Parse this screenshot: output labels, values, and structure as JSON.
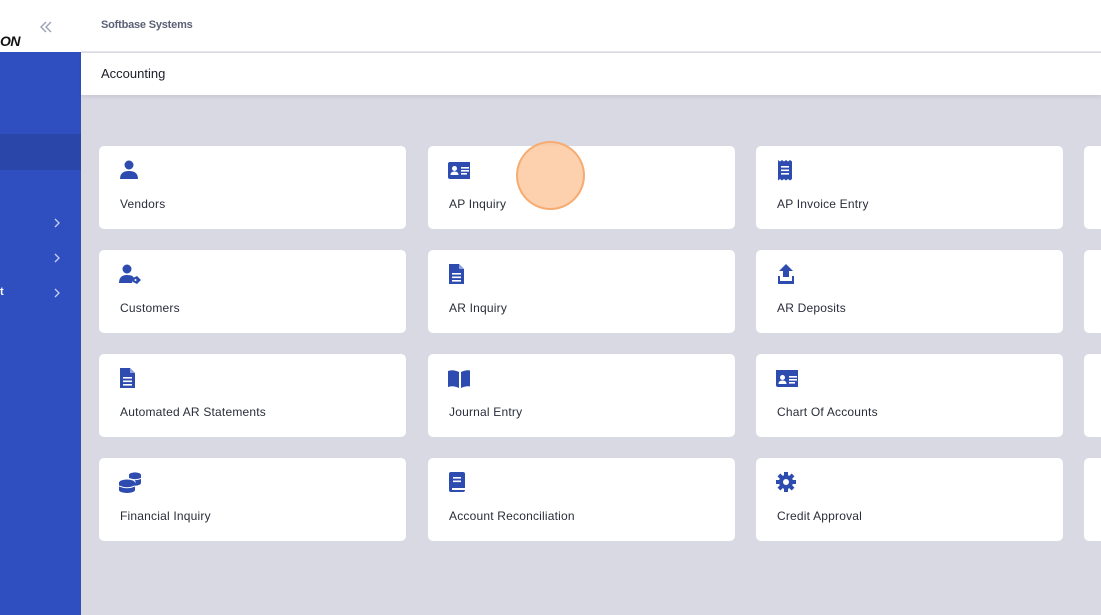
{
  "brand": {
    "logo_fragment": "ON",
    "accent": "#2f4fc0",
    "icon_color": "#2e4caf"
  },
  "header": {
    "company": "Softbase Systems",
    "page_title": "Accounting"
  },
  "sidebar": {
    "items": [
      {
        "label": "",
        "icon": "chevron-right-icon"
      },
      {
        "label": "",
        "icon": "chevron-right-icon"
      },
      {
        "label": "t",
        "icon": "chevron-right-icon"
      }
    ]
  },
  "tiles": [
    {
      "label": "Vendors",
      "icon": "user-icon"
    },
    {
      "label": "AP Inquiry",
      "icon": "id-card-icon"
    },
    {
      "label": "AP Invoice Entry",
      "icon": "receipt-icon"
    },
    {
      "label": "Customers",
      "icon": "user-tag-icon"
    },
    {
      "label": "AR Inquiry",
      "icon": "file-icon"
    },
    {
      "label": "AR Deposits",
      "icon": "upload-icon"
    },
    {
      "label": "Automated AR Statements",
      "icon": "file-icon"
    },
    {
      "label": "Journal Entry",
      "icon": "book-open-icon"
    },
    {
      "label": "Chart Of Accounts",
      "icon": "id-card-icon"
    },
    {
      "label": "Financial Inquiry",
      "icon": "coins-icon"
    },
    {
      "label": "Account Reconciliation",
      "icon": "book-icon"
    },
    {
      "label": "Credit Approval",
      "icon": "gear-icon"
    }
  ]
}
